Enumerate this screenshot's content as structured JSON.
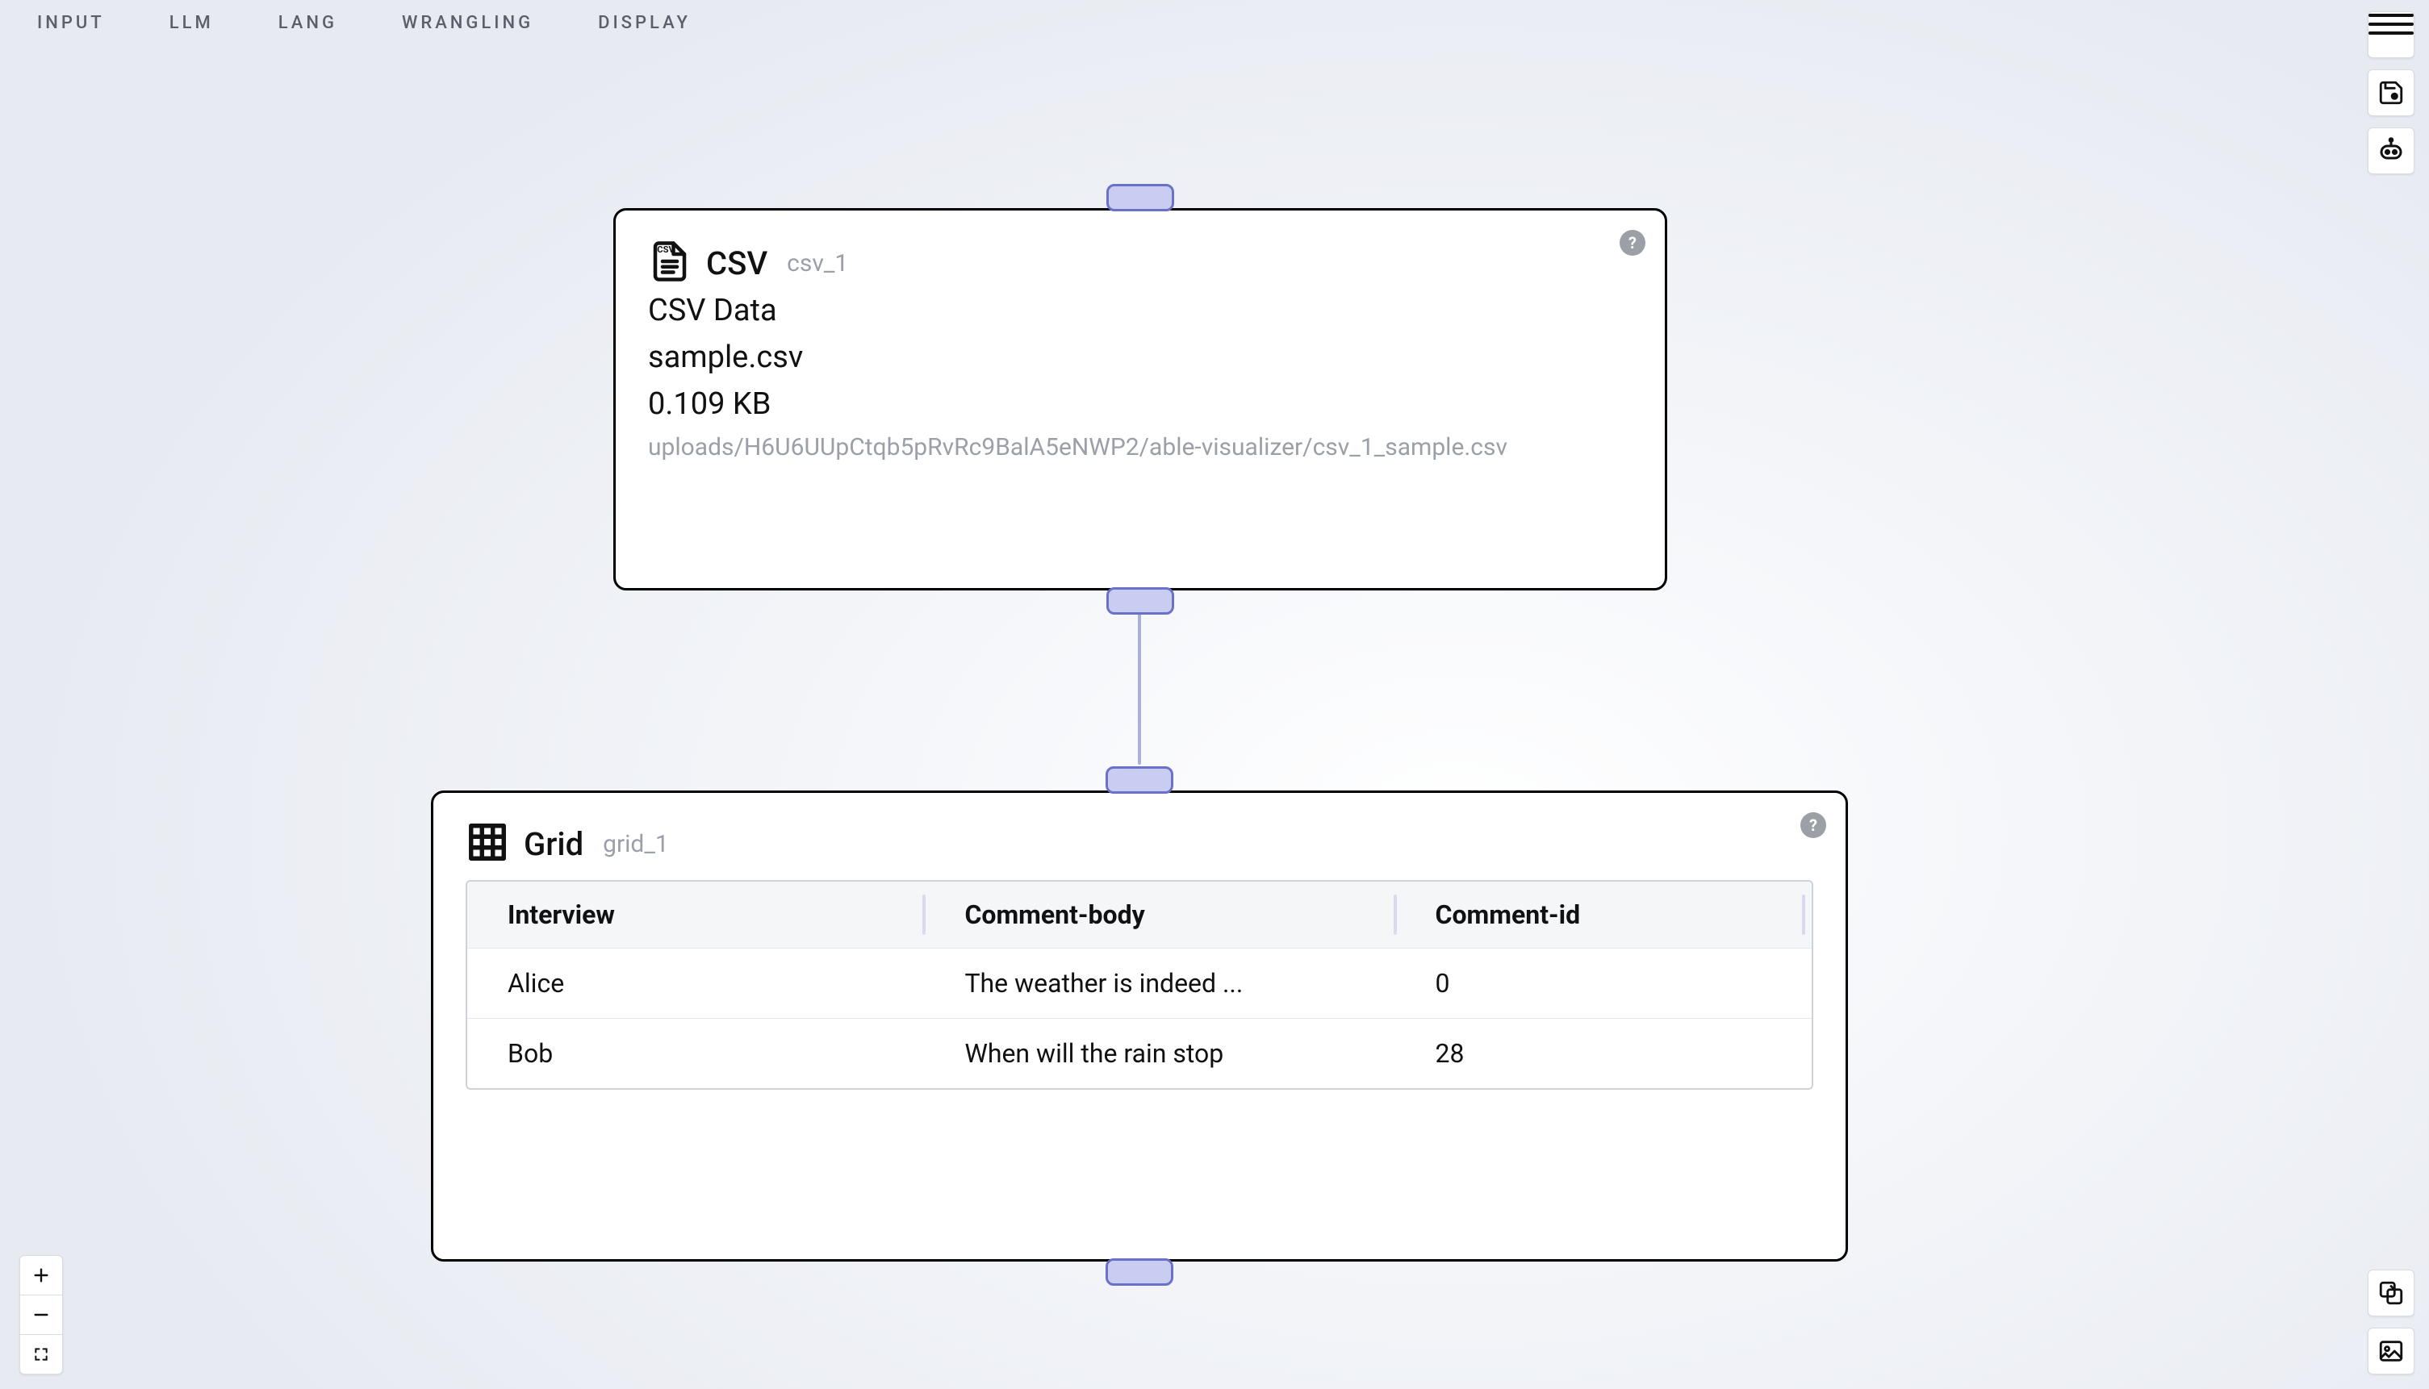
{
  "menu": {
    "items": [
      "INPUT",
      "LLM",
      "LANG",
      "WRANGLING",
      "DISPLAY"
    ]
  },
  "nodes": {
    "csv": {
      "type_label": "CSV",
      "id_label": "csv_1",
      "section_label": "CSV Data",
      "filename": "sample.csv",
      "size_text": "0.109 KB",
      "path": "uploads/H6U6UUpCtqb5pRvRc9BalA5eNWP2/able-visualizer/csv_1_sample.csv"
    },
    "grid": {
      "type_label": "Grid",
      "id_label": "grid_1",
      "columns": [
        "Interview",
        "Comment-body",
        "Comment-id"
      ],
      "rows": [
        {
          "interview": "Alice",
          "comment_body": "The weather is indeed ...",
          "comment_id": "0"
        },
        {
          "interview": "Bob",
          "comment_body": "When will the rain stop",
          "comment_id": "28"
        }
      ]
    }
  },
  "help_glyph": "?",
  "icons": {
    "hamburger": "menu",
    "save": "save",
    "assistant": "robot",
    "code": "screenshot-or-code",
    "image": "image",
    "csv": "csv-file",
    "grid": "grid",
    "pencil": "edit"
  }
}
